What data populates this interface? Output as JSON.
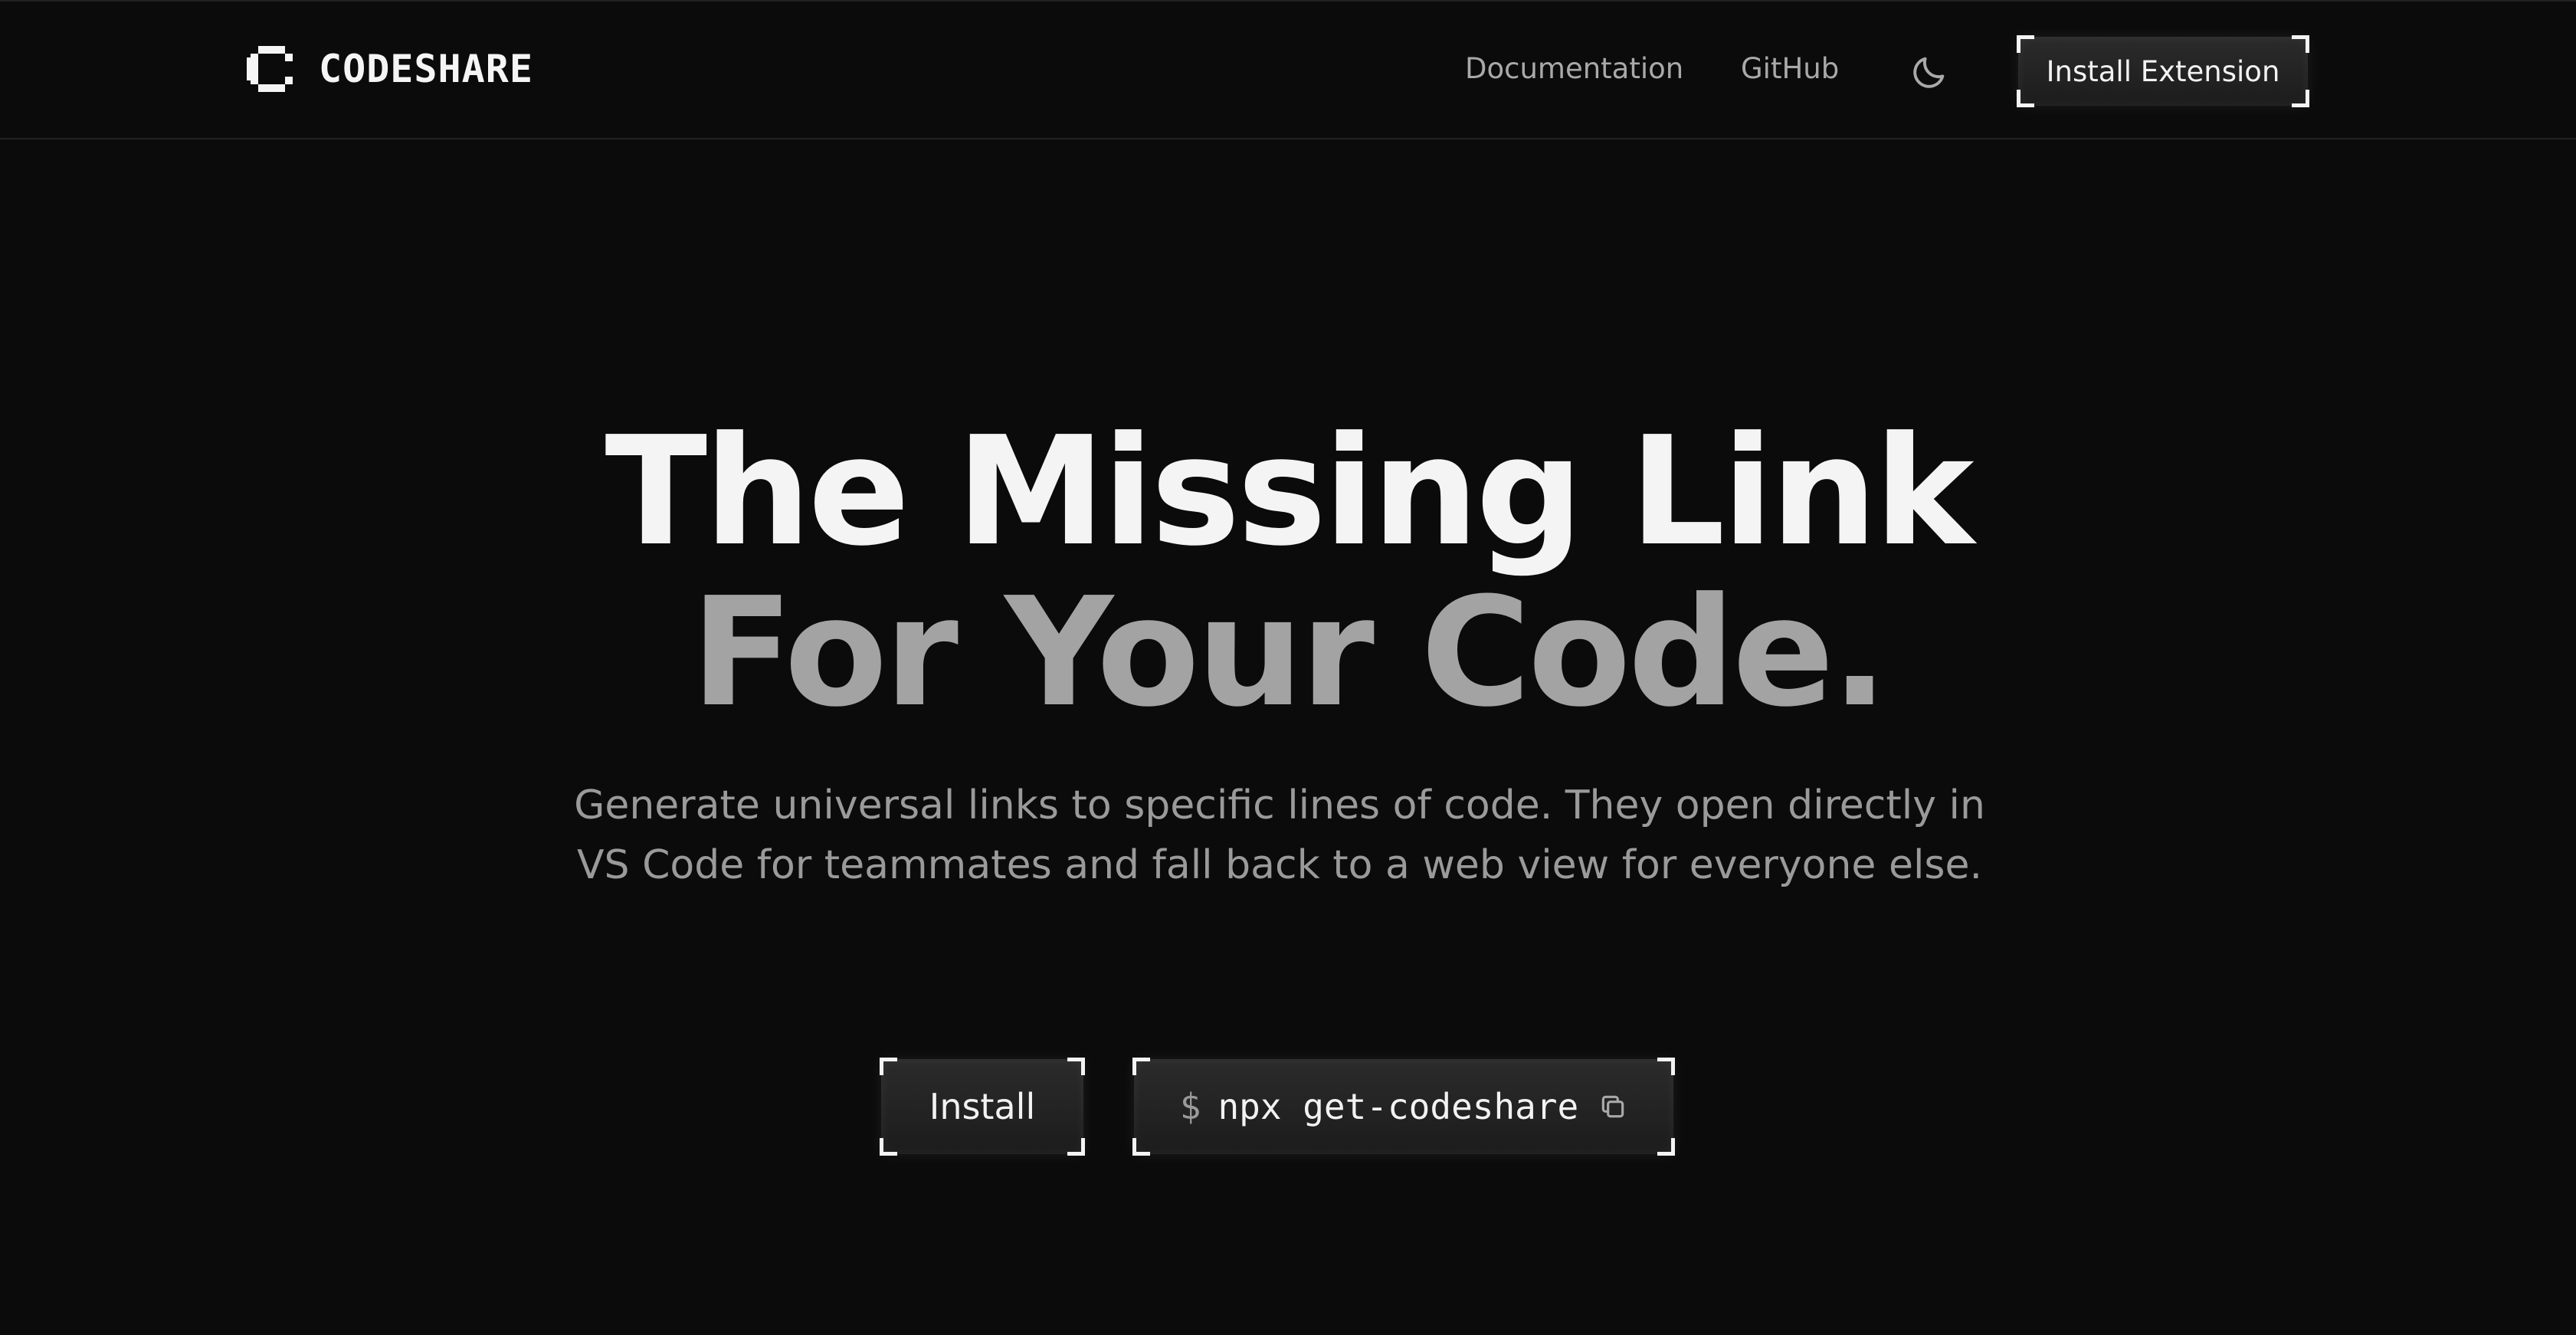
{
  "header": {
    "logo_text": "CODESHARE",
    "logo_icon": "pixel-c-logo",
    "nav": {
      "documentation": "Documentation",
      "github": "GitHub"
    },
    "theme_icon": "moon-icon",
    "install_extension_label": "Install Extension"
  },
  "hero": {
    "title_line1": "The Missing Link",
    "title_line2": "For Your Code.",
    "description": "Generate universal links to specific lines of code. They open directly in VS Code for teammates and fall back to a web view for everyone else.",
    "install_label": "Install",
    "command_prompt": "$",
    "command_text": "npx get-codeshare",
    "copy_icon": "copy-icon"
  },
  "colors": {
    "background": "#0b0b0b",
    "title_primary": "#f4f4f4",
    "title_secondary": "#a3a3a3",
    "muted_text": "#9a9a9a"
  }
}
